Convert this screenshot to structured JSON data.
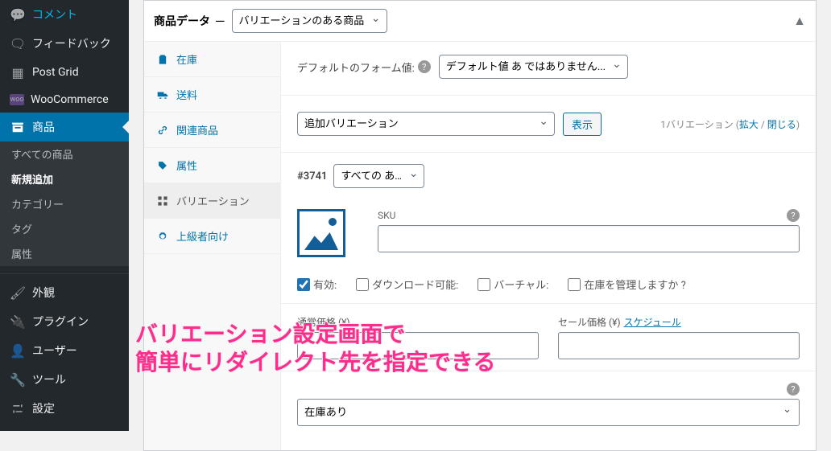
{
  "sidebar": {
    "items": [
      {
        "label": "コメント",
        "icon": "💬"
      },
      {
        "label": "フィードバック",
        "icon": "🗨"
      },
      {
        "label": "Post Grid",
        "icon": "▦"
      },
      {
        "label": "WooCommerce",
        "icon": "woo"
      },
      {
        "label": "商品",
        "icon": "📦"
      }
    ],
    "sub": [
      {
        "label": "すべての商品"
      },
      {
        "label": "新規追加"
      },
      {
        "label": "カテゴリー"
      },
      {
        "label": "タグ"
      },
      {
        "label": "属性"
      }
    ],
    "items2": [
      {
        "label": "外観",
        "icon": "🖌"
      },
      {
        "label": "プラグイン",
        "icon": "🔌"
      },
      {
        "label": "ユーザー",
        "icon": "👤"
      },
      {
        "label": "ツール",
        "icon": "🔧"
      },
      {
        "label": "設定",
        "icon": "⚙"
      }
    ]
  },
  "panel": {
    "title": "商品データ",
    "dash": "—",
    "product_type": "バリエーションのある商品"
  },
  "tabs": [
    {
      "label": "在庫",
      "icon": "clipboard"
    },
    {
      "label": "送料",
      "icon": "truck"
    },
    {
      "label": "関連商品",
      "icon": "link"
    },
    {
      "label": "属性",
      "icon": "tags"
    },
    {
      "label": "バリエーション",
      "icon": "grid"
    },
    {
      "label": "上級者向け",
      "icon": "gear"
    }
  ],
  "form": {
    "default_form_label": "デフォルトのフォーム値:",
    "default_form_value": "デフォルト値 あ ではありません...",
    "add_variation_select": "追加バリエーション",
    "show_button": "表示",
    "variation_count": "1バリエーション (",
    "expand": "拡大",
    "slash": " / ",
    "collapse": "閉じる",
    "close_paren": ")",
    "variation_id": "#3741",
    "variation_attr_select": "すべての あ…",
    "sku_label": "SKU",
    "chk_enabled": "有効:",
    "chk_download": "ダウンロード可能:",
    "chk_virtual": "バーチャル:",
    "chk_managestock": "在庫を管理しますか ?",
    "regular_price_label": "通常価格 (¥)",
    "sale_price_label": "セール価格 (¥)",
    "schedule_link": "スケジュール",
    "stock_status_value": "在庫あり"
  },
  "annotation": {
    "line1": "バリエーション設定画面で",
    "line2": "簡単にリダイレクト先を指定できる"
  }
}
